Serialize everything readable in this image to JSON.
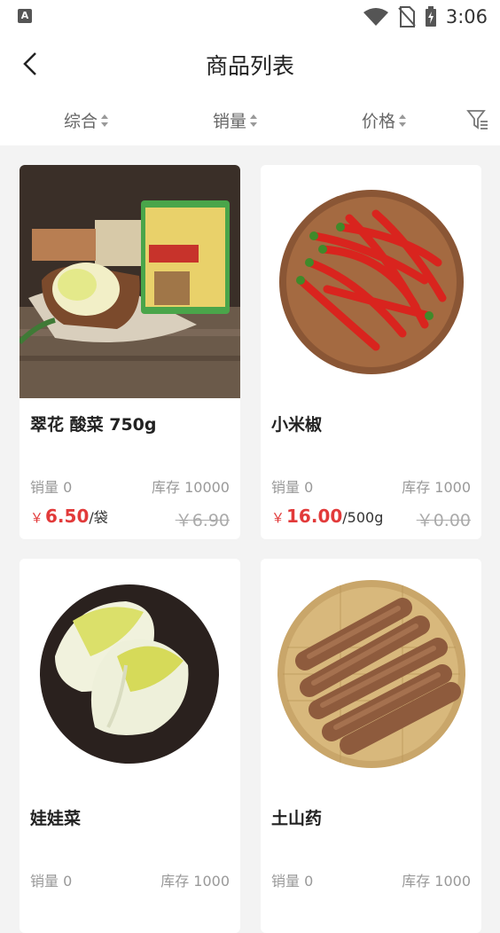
{
  "status_bar": {
    "time": "3:06",
    "app_icon_letter": "A"
  },
  "header": {
    "title": "商品列表"
  },
  "sort": {
    "items": [
      {
        "label": "综合"
      },
      {
        "label": "销量"
      },
      {
        "label": "价格"
      }
    ]
  },
  "products": [
    {
      "name": "翠花 酸菜 750g",
      "sales": "销量 0",
      "stock": "库存 10000",
      "currency": "￥",
      "price": "6.50",
      "unit": "/袋",
      "original_price": "￥6.90"
    },
    {
      "name": "小米椒",
      "sales": "销量 0",
      "stock": "库存 1000",
      "currency": "￥",
      "price": "16.00",
      "unit": "/500g",
      "original_price": "￥0.00"
    },
    {
      "name": "娃娃菜",
      "sales": "销量 0",
      "stock": "库存 1000"
    },
    {
      "name": "土山药",
      "sales": "销量 0",
      "stock": "库存 1000"
    }
  ],
  "colors": {
    "accent_price": "#e23a3a",
    "background": "#f3f3f3"
  }
}
